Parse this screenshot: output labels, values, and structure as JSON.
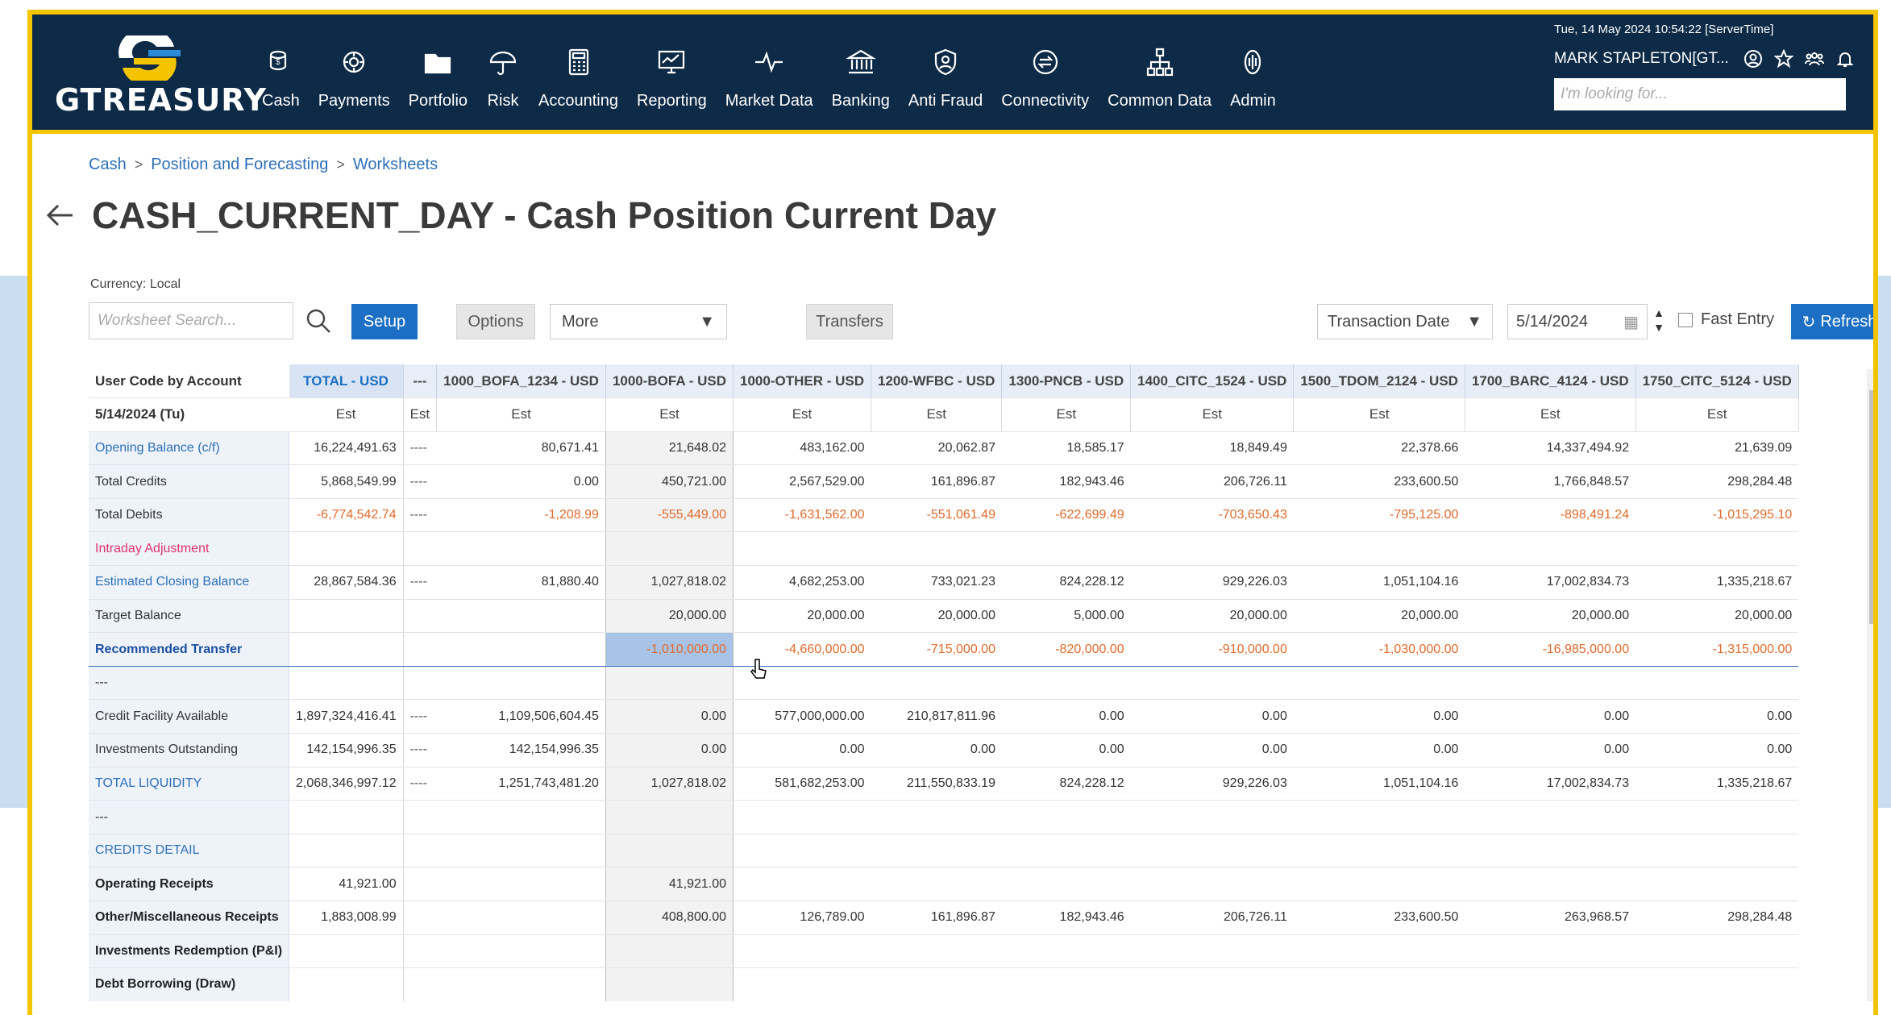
{
  "header": {
    "logo_text": "GTREASURY",
    "nav": [
      {
        "label": "Cash",
        "icon": "cash-icon"
      },
      {
        "label": "Payments",
        "icon": "payments-icon"
      },
      {
        "label": "Portfolio",
        "icon": "folder-icon"
      },
      {
        "label": "Risk",
        "icon": "umbrella-icon"
      },
      {
        "label": "Accounting",
        "icon": "calculator-icon"
      },
      {
        "label": "Reporting",
        "icon": "monitor-chart-icon"
      },
      {
        "label": "Market Data",
        "icon": "pulse-icon"
      },
      {
        "label": "Banking",
        "icon": "bank-icon"
      },
      {
        "label": "Anti Fraud",
        "icon": "shield-user-icon"
      },
      {
        "label": "Connectivity",
        "icon": "connectivity-icon"
      },
      {
        "label": "Common Data",
        "icon": "hierarchy-icon"
      },
      {
        "label": "Admin",
        "icon": "fingerprint-icon"
      }
    ],
    "server_time": "Tue, 14 May 2024 10:54:22 [ServerTime]",
    "user": "MARK STAPLETON[GT...",
    "search_placeholder": "I'm looking for..."
  },
  "breadcrumb": [
    "Cash",
    "Position and Forecasting",
    "Worksheets"
  ],
  "page_title": "CASH_CURRENT_DAY - Cash Position Current Day",
  "toolbar": {
    "currency_label": "Currency:",
    "currency_value": "Local",
    "search_placeholder": "Worksheet Search...",
    "setup": "Setup",
    "options": "Options",
    "more": "More",
    "transfers": "Transfers",
    "date_type": "Transaction Date",
    "date": "5/14/2024",
    "fast_entry": "Fast Entry",
    "refresh": "Refresh"
  },
  "grid": {
    "corner_label": "User Code by Account",
    "date_label": "5/14/2024 (Tu)",
    "columns": [
      "TOTAL - USD",
      "---",
      "1000_BOFA_1234 - USD",
      "1000-BOFA - USD",
      "1000-OTHER - USD",
      "1200-WFBC - USD",
      "1300-PNCB - USD",
      "1400_CITC_1524 - USD",
      "1500_TDOM_2124 - USD",
      "1700_BARC_4124 - USD",
      "1750_CITC_5124 - USD"
    ],
    "subheaders": [
      "Est",
      "Est",
      "Est",
      "Est",
      "Est",
      "Est",
      "Est",
      "Est",
      "Est",
      "Est",
      "Est"
    ],
    "rows": [
      {
        "label": "Opening Balance (c/f)",
        "style": "blue",
        "values": [
          "16,224,491.63",
          "----",
          "80,671.41",
          "21,648.02",
          "483,162.00",
          "20,062.87",
          "18,585.17",
          "18,849.49",
          "22,378.66",
          "14,337,494.92",
          "21,639.09"
        ]
      },
      {
        "label": "Total Credits",
        "style": "",
        "values": [
          "5,868,549.99",
          "----",
          "0.00",
          "450,721.00",
          "2,567,529.00",
          "161,896.87",
          "182,943.46",
          "206,726.11",
          "233,600.50",
          "1,766,848.57",
          "298,284.48"
        ]
      },
      {
        "label": "Total Debits",
        "style": "",
        "neg": true,
        "values": [
          "-6,774,542.74",
          "----",
          "-1,208.99",
          "-555,449.00",
          "-1,631,562.00",
          "-551,061.49",
          "-622,699.49",
          "-703,650.43",
          "-795,125.00",
          "-898,491.24",
          "-1,015,295.10"
        ]
      },
      {
        "label": "Intraday Adjustment",
        "style": "pink",
        "values": [
          "",
          "",
          "",
          "",
          "",
          "",
          "",
          "",
          "",
          "",
          ""
        ]
      },
      {
        "label": "Estimated Closing Balance",
        "style": "blue",
        "values": [
          "28,867,584.36",
          "----",
          "81,880.40",
          "1,027,818.02",
          "4,682,253.00",
          "733,021.23",
          "824,228.12",
          "929,226.03",
          "1,051,104.16",
          "17,002,834.73",
          "1,335,218.67"
        ]
      },
      {
        "label": "Target Balance",
        "style": "",
        "values": [
          "",
          "",
          "",
          "20,000.00",
          "20,000.00",
          "20,000.00",
          "5,000.00",
          "20,000.00",
          "20,000.00",
          "20,000.00",
          "20,000.00"
        ]
      },
      {
        "label": "Recommended Transfer",
        "style": "rec",
        "neg": true,
        "values": [
          "",
          "",
          "",
          "-1,010,000.00",
          "-4,660,000.00",
          "-715,000.00",
          "-820,000.00",
          "-910,000.00",
          "-1,030,000.00",
          "-16,985,000.00",
          "-1,315,000.00"
        ]
      },
      {
        "label": "---",
        "style": "",
        "values": [
          "",
          "",
          "",
          "",
          "",
          "",
          "",
          "",
          "",
          "",
          ""
        ]
      },
      {
        "label": "Credit Facility Available",
        "style": "",
        "values": [
          "1,897,324,416.41",
          "----",
          "1,109,506,604.45",
          "0.00",
          "577,000,000.00",
          "210,817,811.96",
          "0.00",
          "0.00",
          "0.00",
          "0.00",
          "0.00"
        ]
      },
      {
        "label": "Investments Outstanding",
        "style": "",
        "values": [
          "142,154,996.35",
          "----",
          "142,154,996.35",
          "0.00",
          "0.00",
          "0.00",
          "0.00",
          "0.00",
          "0.00",
          "0.00",
          "0.00"
        ]
      },
      {
        "label": "TOTAL LIQUIDITY",
        "style": "blue",
        "values": [
          "2,068,346,997.12",
          "----",
          "1,251,743,481.20",
          "1,027,818.02",
          "581,682,253.00",
          "211,550,833.19",
          "824,228.12",
          "929,226.03",
          "1,051,104.16",
          "17,002,834.73",
          "1,335,218.67"
        ]
      },
      {
        "label": "---",
        "style": "",
        "values": [
          "",
          "",
          "",
          "",
          "",
          "",
          "",
          "",
          "",
          "",
          ""
        ]
      },
      {
        "label": "CREDITS DETAIL",
        "style": "blue",
        "values": [
          "",
          "",
          "",
          "",
          "",
          "",
          "",
          "",
          "",
          "",
          ""
        ]
      },
      {
        "label": "Operating Receipts",
        "style": "bold",
        "values": [
          "41,921.00",
          "",
          "",
          "41,921.00",
          "",
          "",
          "",
          "",
          "",
          "",
          ""
        ]
      },
      {
        "label": "Other/Miscellaneous Receipts",
        "style": "bold",
        "values": [
          "1,883,008.99",
          "",
          "",
          "408,800.00",
          "126,789.00",
          "161,896.87",
          "182,943.46",
          "206,726.11",
          "233,600.50",
          "263,968.57",
          "298,284.48"
        ]
      },
      {
        "label": "Investments Redemption (P&I)",
        "style": "bold",
        "values": [
          "",
          "",
          "",
          "",
          "",
          "",
          "",
          "",
          "",
          "",
          ""
        ]
      },
      {
        "label": "Debt Borrowing (Draw)",
        "style": "bold",
        "values": [
          "",
          "",
          "",
          "",
          "",
          "",
          "",
          "",
          "",
          "",
          ""
        ]
      }
    ]
  },
  "colors": {
    "nav_bg": "#0d2a47",
    "accent": "#f5c400",
    "primary": "#1c6fc4",
    "negative": "#e06a2c"
  }
}
